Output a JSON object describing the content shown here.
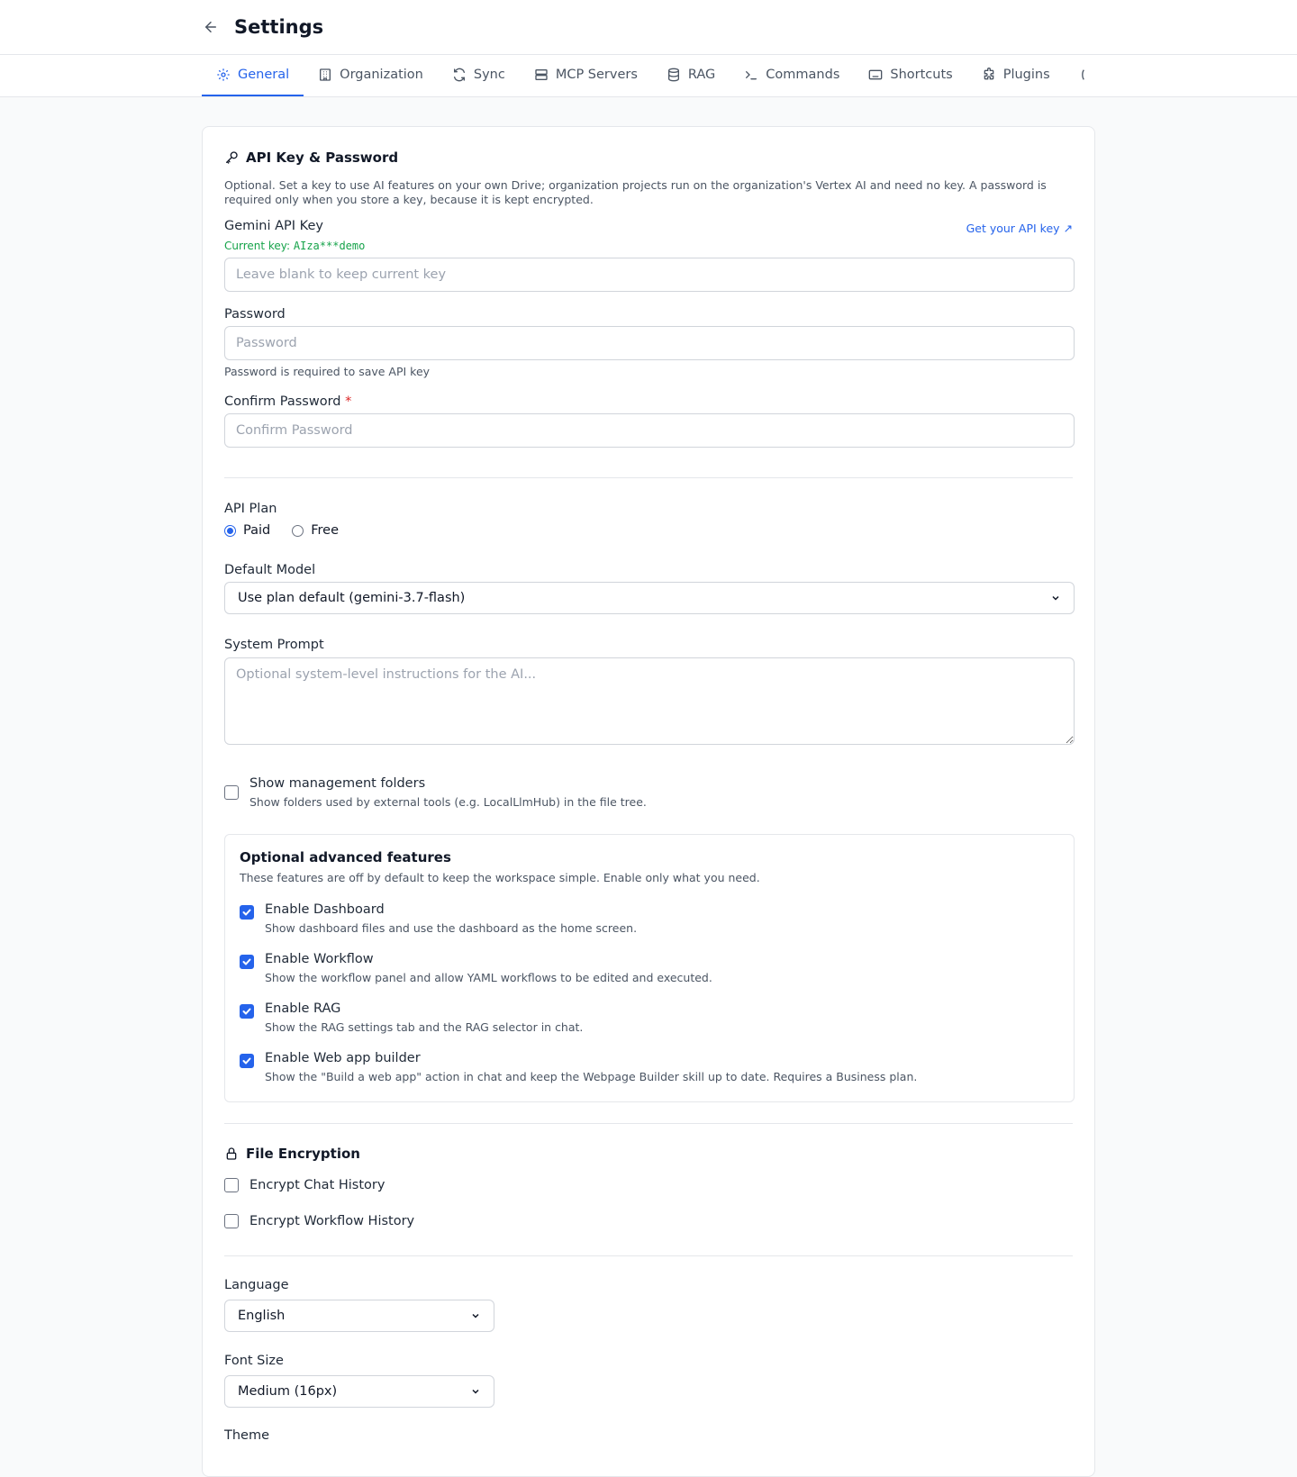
{
  "header": {
    "title": "Settings"
  },
  "tabs": [
    {
      "label": "General",
      "icon": "gear-icon",
      "active": true
    },
    {
      "label": "Organization",
      "icon": "building-icon",
      "active": false
    },
    {
      "label": "Sync",
      "icon": "sync-icon",
      "active": false
    },
    {
      "label": "MCP Servers",
      "icon": "server-icon",
      "active": false
    },
    {
      "label": "RAG",
      "icon": "database-icon",
      "active": false
    },
    {
      "label": "Commands",
      "icon": "terminal-icon",
      "active": false
    },
    {
      "label": "Shortcuts",
      "icon": "keyboard-icon",
      "active": false
    },
    {
      "label": "Plugins",
      "icon": "puzzle-icon",
      "active": false
    }
  ],
  "api": {
    "title": "API Key & Password",
    "description": "Optional. Set a key to use AI features on your own Drive; organization projects run on the organization's Vertex AI and need no key. A password is required only when you store a key, because it is kept encrypted.",
    "gemini_label": "Gemini API Key",
    "get_key_link": "Get your API key ↗",
    "current_key_prefix": "Current key: ",
    "current_key_value": "AIza***demo",
    "key_placeholder": "Leave blank to keep current key",
    "password_label": "Password",
    "password_placeholder": "Password",
    "password_hint": "Password is required to save API key",
    "confirm_label": "Confirm Password",
    "confirm_required": "*",
    "confirm_placeholder": "Confirm Password"
  },
  "plan": {
    "label": "API Plan",
    "options": [
      {
        "label": "Paid",
        "selected": true
      },
      {
        "label": "Free",
        "selected": false
      }
    ]
  },
  "model": {
    "label": "Default Model",
    "selected": "Use plan default (gemini-3.7-flash)"
  },
  "system_prompt": {
    "label": "System Prompt",
    "placeholder": "Optional system-level instructions for the AI..."
  },
  "management_folders": {
    "label": "Show management folders",
    "description": "Show folders used by external tools (e.g. LocalLlmHub) in the file tree.",
    "checked": false
  },
  "advanced": {
    "title": "Optional advanced features",
    "description": "These features are off by default to keep the workspace simple. Enable only what you need.",
    "items": [
      {
        "label": "Enable Dashboard",
        "description": "Show dashboard files and use the dashboard as the home screen.",
        "checked": true
      },
      {
        "label": "Enable Workflow",
        "description": "Show the workflow panel and allow YAML workflows to be edited and executed.",
        "checked": true
      },
      {
        "label": "Enable RAG",
        "description": "Show the RAG settings tab and the RAG selector in chat.",
        "checked": true
      },
      {
        "label": "Enable Web app builder",
        "description": "Show the \"Build a web app\" action in chat and keep the Webpage Builder skill up to date. Requires a Business plan.",
        "checked": true
      }
    ]
  },
  "encryption": {
    "title": "File Encryption",
    "items": [
      {
        "label": "Encrypt Chat History",
        "checked": false
      },
      {
        "label": "Encrypt Workflow History",
        "checked": false
      }
    ]
  },
  "language": {
    "label": "Language",
    "selected": "English"
  },
  "font_size": {
    "label": "Font Size",
    "selected": "Medium (16px)"
  },
  "theme": {
    "label": "Theme"
  },
  "colors": {
    "accent": "#2563eb",
    "success": "#16a34a",
    "required": "#dc2626"
  }
}
